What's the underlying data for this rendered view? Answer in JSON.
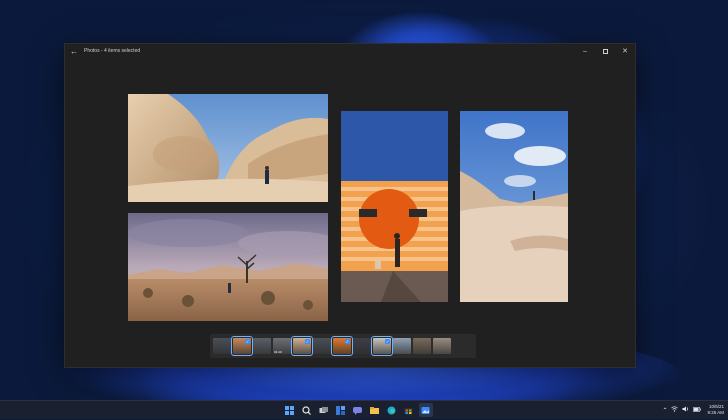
{
  "window": {
    "title": "Photos - 4 items selected",
    "back_icon": "arrow-left-icon",
    "controls": [
      "minimize-icon",
      "maximize-icon",
      "close-icon"
    ]
  },
  "photos": [
    {
      "name": "desert-boulders-hiker",
      "selected": true
    },
    {
      "name": "joshua-tree-landscape",
      "selected": true
    },
    {
      "name": "orange-sun-mural-wall",
      "selected": true
    },
    {
      "name": "rock-slope-blue-sky",
      "selected": true
    }
  ],
  "filmstrip": {
    "thumbnails": [
      {
        "selected": false,
        "tone": "#4a4f58"
      },
      {
        "selected": true,
        "tone": "#c98a5a"
      },
      {
        "selected": false,
        "tone": "#5a5f66"
      },
      {
        "selected": false,
        "tone": "#6c6f76",
        "duration": "01:40"
      },
      {
        "selected": true,
        "tone": "#d0b090"
      },
      {
        "selected": false,
        "tone": "#4a4f58"
      },
      {
        "selected": true,
        "tone": "#e07a2a"
      },
      {
        "selected": false,
        "tone": "#3c3f44"
      },
      {
        "selected": true,
        "tone": "#c9c4bc"
      },
      {
        "selected": false,
        "tone": "#8fa0b4"
      },
      {
        "selected": false,
        "tone": "#7a6a5a"
      },
      {
        "selected": false,
        "tone": "#9a8c80"
      }
    ]
  },
  "taskbar": {
    "icons": [
      "windows-start-icon",
      "search-icon",
      "task-view-icon",
      "widgets-icon",
      "chat-icon",
      "file-explorer-icon",
      "edge-browser-icon",
      "store-icon",
      "photos-icon"
    ],
    "active_index": 8,
    "tray_icons": [
      "chevron-up-icon",
      "wifi-icon",
      "volume-icon",
      "battery-icon"
    ],
    "date": "10/6/21",
    "time": "9:26 AM"
  },
  "colors": {
    "accent": "#3a8cff",
    "window_bg": "#202020"
  }
}
